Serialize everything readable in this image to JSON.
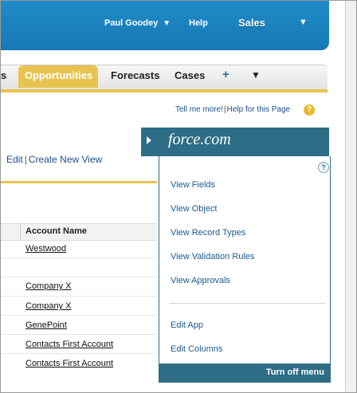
{
  "header": {
    "user_name": "Paul Goodey",
    "help_label": "Help",
    "app_name": "Sales"
  },
  "tabs": {
    "partial_left": "s",
    "items": [
      {
        "label": "Opportunities",
        "active": true
      },
      {
        "label": "Forecasts",
        "active": false
      },
      {
        "label": "Cases",
        "active": false
      }
    ],
    "plus_label": "+",
    "more_label": "▼"
  },
  "help_links": {
    "tell_more": "Tell me more!",
    "help_page": "Help for this Page",
    "separator": "|"
  },
  "view_links": {
    "edit": "Edit",
    "create_new_view": "Create New View",
    "separator": "|"
  },
  "table": {
    "column_header": "Account Name",
    "rows": [
      "Westwood",
      "",
      "Company X",
      "Company X",
      "GenePoint",
      "Contacts First Account",
      "Contacts First Account"
    ]
  },
  "force_menu": {
    "logo_text": "force.com",
    "help_glyph": "?",
    "items": [
      "View Fields",
      "View Object",
      "View Record Types",
      "View Validation Rules",
      "View Approvals"
    ],
    "items_secondary": [
      "Edit App",
      "Edit Columns"
    ],
    "turn_off": "Turn off menu"
  },
  "colors": {
    "header_blue": "#1679b4",
    "tab_gold": "#e8c34e",
    "menu_teal": "#2e6d86",
    "link_blue": "#1b4f8a"
  }
}
